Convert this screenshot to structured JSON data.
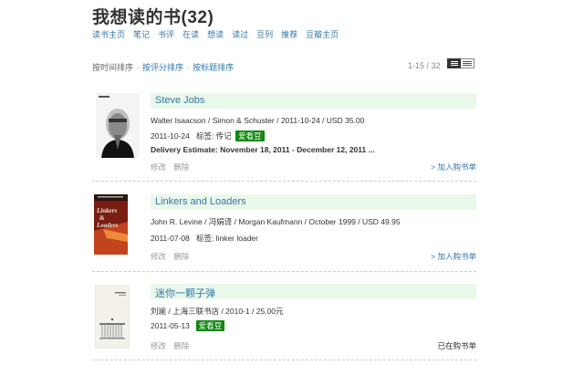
{
  "header": {
    "title": "我想读的书(32)"
  },
  "nav": [
    "读书主页",
    "笔记",
    "书评",
    "在读",
    "想读",
    "读过",
    "豆列",
    "推荐",
    "豆瓣主页"
  ],
  "sort": {
    "current": "按时间排序",
    "sep1": "·",
    "option1": "按评分排序",
    "sep2": "·",
    "option2": "按标题排序"
  },
  "pager": {
    "range": "1-15 / 32"
  },
  "books": [
    {
      "title": "Steve Jobs",
      "meta": "Walter Isaacson / Simon & Schuster / 2011-10-24 / USD 35.00",
      "date": "2011-10-24",
      "tags": "标签: 传记",
      "badge": "爱看豆",
      "delivery": "Delivery Estimate: November 18, 2011 - December 12, 2011 ...",
      "edit": "修改",
      "delete": "删除",
      "action": "> 加入购书单"
    },
    {
      "title": "Linkers and Loaders",
      "meta": "John R. Levine / 冯娟译 / Morgan Kaufmann / October 1999 / USD 49.95",
      "date": "2011-07-08",
      "tags": "标签: linker loader",
      "edit": "修改",
      "delete": "删除",
      "action": "> 加入购书单",
      "cover_text": [
        "Linkers",
        "&",
        "Loaders"
      ]
    },
    {
      "title": "迷你一颗子弹",
      "meta": "刘瑜 / 上海三联书店 / 2010-1 / 25.00元",
      "date": "2011-05-13",
      "badge": "爱看豆",
      "edit": "修改",
      "delete": "删除",
      "action": "已在购书单"
    }
  ]
}
